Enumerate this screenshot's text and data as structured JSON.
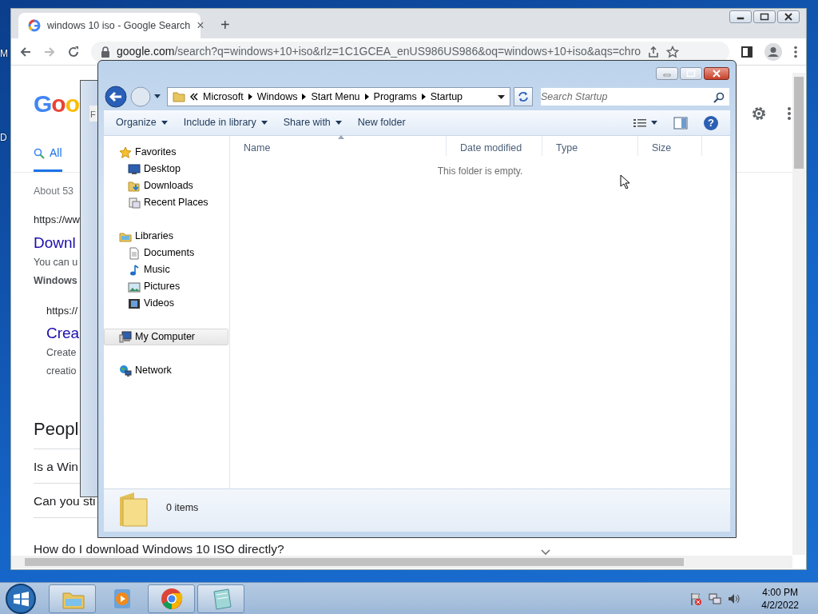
{
  "desktop": {
    "icon_labels": [
      "M",
      "D"
    ]
  },
  "browser": {
    "tab": {
      "title": "windows 10 iso - Google Search",
      "close": "×"
    },
    "new_tab": "+",
    "address": "google.com/search?q=windows+10+iso&rlz=1C1GCEA_enUS986US986&oq=windows+10+iso&aqs=chro",
    "logo": "Goo",
    "search_tabs": [
      {
        "label": "All",
        "selected": true
      }
    ],
    "result_stats": "About 53",
    "results": [
      {
        "url": "https://ww",
        "title": "Downl",
        "snippet_lines": [
          "You can u",
          "**Windows**"
        ],
        "children": [
          {
            "url": "https://",
            "title": "Crea",
            "snippet_lines": [
              "Create",
              "creatio"
            ]
          }
        ]
      }
    ],
    "people_also_ask": {
      "heading": "Peopl",
      "questions": [
        "Is a Win",
        "Can you sti",
        "How do I download Windows 10 ISO directly?"
      ]
    }
  },
  "background_window": {
    "label": "F"
  },
  "explorer": {
    "breadcrumb": [
      "Microsoft",
      "Windows",
      "Start Menu",
      "Programs",
      "Startup"
    ],
    "search": {
      "placeholder": "Search Startup"
    },
    "toolbar": [
      {
        "label": "Organize",
        "dropdown": true
      },
      {
        "label": "Include in library",
        "dropdown": true
      },
      {
        "label": "Share with",
        "dropdown": true
      },
      {
        "label": "New folder",
        "dropdown": false
      }
    ],
    "nav": [
      {
        "label": "Favorites",
        "kind": "star",
        "selected": false,
        "children": [
          {
            "label": "Desktop",
            "kind": "desktop",
            "selected": false
          },
          {
            "label": "Downloads",
            "kind": "downloads",
            "selected": false
          },
          {
            "label": "Recent Places",
            "kind": "recent",
            "selected": false
          }
        ]
      },
      {
        "label": "Libraries",
        "kind": "libraries",
        "selected": false,
        "children": [
          {
            "label": "Documents",
            "kind": "documents",
            "selected": false
          },
          {
            "label": "Music",
            "kind": "music",
            "selected": false
          },
          {
            "label": "Pictures",
            "kind": "pictures",
            "selected": false
          },
          {
            "label": "Videos",
            "kind": "videos",
            "selected": false
          }
        ]
      },
      {
        "label": "My Computer",
        "kind": "computer",
        "selected": true
      },
      {
        "label": "Network",
        "kind": "network",
        "selected": false
      }
    ],
    "columns": [
      {
        "label": "Name",
        "sorted": true
      },
      {
        "label": "Date modified",
        "sorted": false
      },
      {
        "label": "Type",
        "sorted": false
      },
      {
        "label": "Size",
        "sorted": false
      }
    ],
    "help": "?",
    "empty_message": "This folder is empty.",
    "status": "0 items"
  },
  "taskbar": {
    "apps": [
      {
        "kind": "explorer",
        "running": true
      },
      {
        "kind": "media",
        "running": false
      },
      {
        "kind": "chrome",
        "running": true
      },
      {
        "kind": "notepad",
        "running": true
      }
    ],
    "time": "4:00 PM",
    "date": "4/2/2022"
  }
}
